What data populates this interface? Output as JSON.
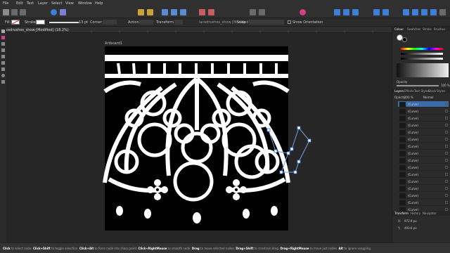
{
  "menu": [
    "File",
    "Edit",
    "Text",
    "Layer",
    "Select",
    "View",
    "Window",
    "Help"
  ],
  "context": {
    "fill_label": "Fill:",
    "stroke_label": "Stroke:",
    "stroke_width": "13 pt",
    "corner_label": "Corner",
    "action_label": "Action",
    "transform_label": "Transform",
    "snap_label": "Snap",
    "show_orientation": "Show Orientation"
  },
  "document": {
    "tab_title": "lacedrushes_show [Modified] (18.2%)",
    "artboard_label": "Artboard1"
  },
  "panels": {
    "top_tabs": [
      "Colour",
      "Swatches",
      "Stroke",
      "Brushes"
    ],
    "opacity_label": "Opacity",
    "opacity_value": "100 %",
    "layer_tabs": [
      "Layers",
      "Effects",
      "Text Styles",
      "Stock",
      "Styles"
    ],
    "layer_opacity_label": "Opacity:",
    "layer_opacity_value": "100 %",
    "blend_mode": "Normal",
    "layers": [
      "(Curve)",
      "(Curve)",
      "(Curve)",
      "(Curve)",
      "(Curve)",
      "(Curve)",
      "(Curve)",
      "(Curve)",
      "(Curve)",
      "(Curve)",
      "(Curve)",
      "(Curve)",
      "(Curve)",
      "(Curve)",
      "(Curve)",
      "(Curve)"
    ],
    "transform_tabs": [
      "Transform",
      "History",
      "Navigator"
    ],
    "x_label": "X:",
    "x_value": "972.9 px",
    "y_label": "Y:",
    "y_value": "493.6 px"
  },
  "status": {
    "s1": "Click",
    "s2": " to select node. ",
    "s3": "Click+Shift",
    "s4": " to toggle selection. ",
    "s5": "Click+Alt",
    "s6": " to force node into sharp point. ",
    "s7": "Click+RightMouse",
    "s8": " to smooth node. ",
    "s9": "Drag",
    "s10": " to move selected nodes. ",
    "s11": "Drag+Shift",
    "s12": " to constrain drag. ",
    "s13": "Drag+RightMouse",
    "s14": " to move just nodes. ",
    "s15": "Alt",
    "s16": " to ignore snapping."
  },
  "colors": {
    "accent": "#4a90d9",
    "selection_outline": "#6fa3e0",
    "canvas_bg": "#262626",
    "artboard_black": "#000000",
    "lace_white": "#ffffff"
  }
}
